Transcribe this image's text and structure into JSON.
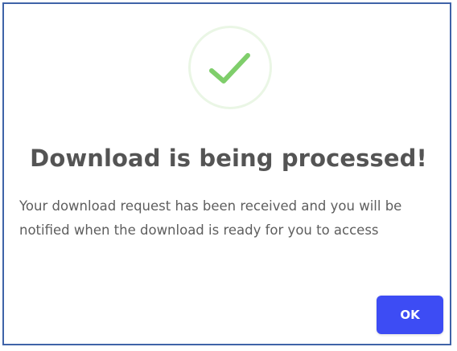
{
  "dialog": {
    "title": "Download is being processed!",
    "message": "Your download request has been received and you will be notified when the download is ready for you to access",
    "ok_label": "OK",
    "icon": "checkmark-icon"
  },
  "colors": {
    "border": "#3f63a8",
    "check": "#7fce6b",
    "circle_ring": "#eaf6e5",
    "title": "#545454",
    "message": "#5e5e5e",
    "button": "#3d4cf4",
    "button_text": "#ffffff"
  }
}
